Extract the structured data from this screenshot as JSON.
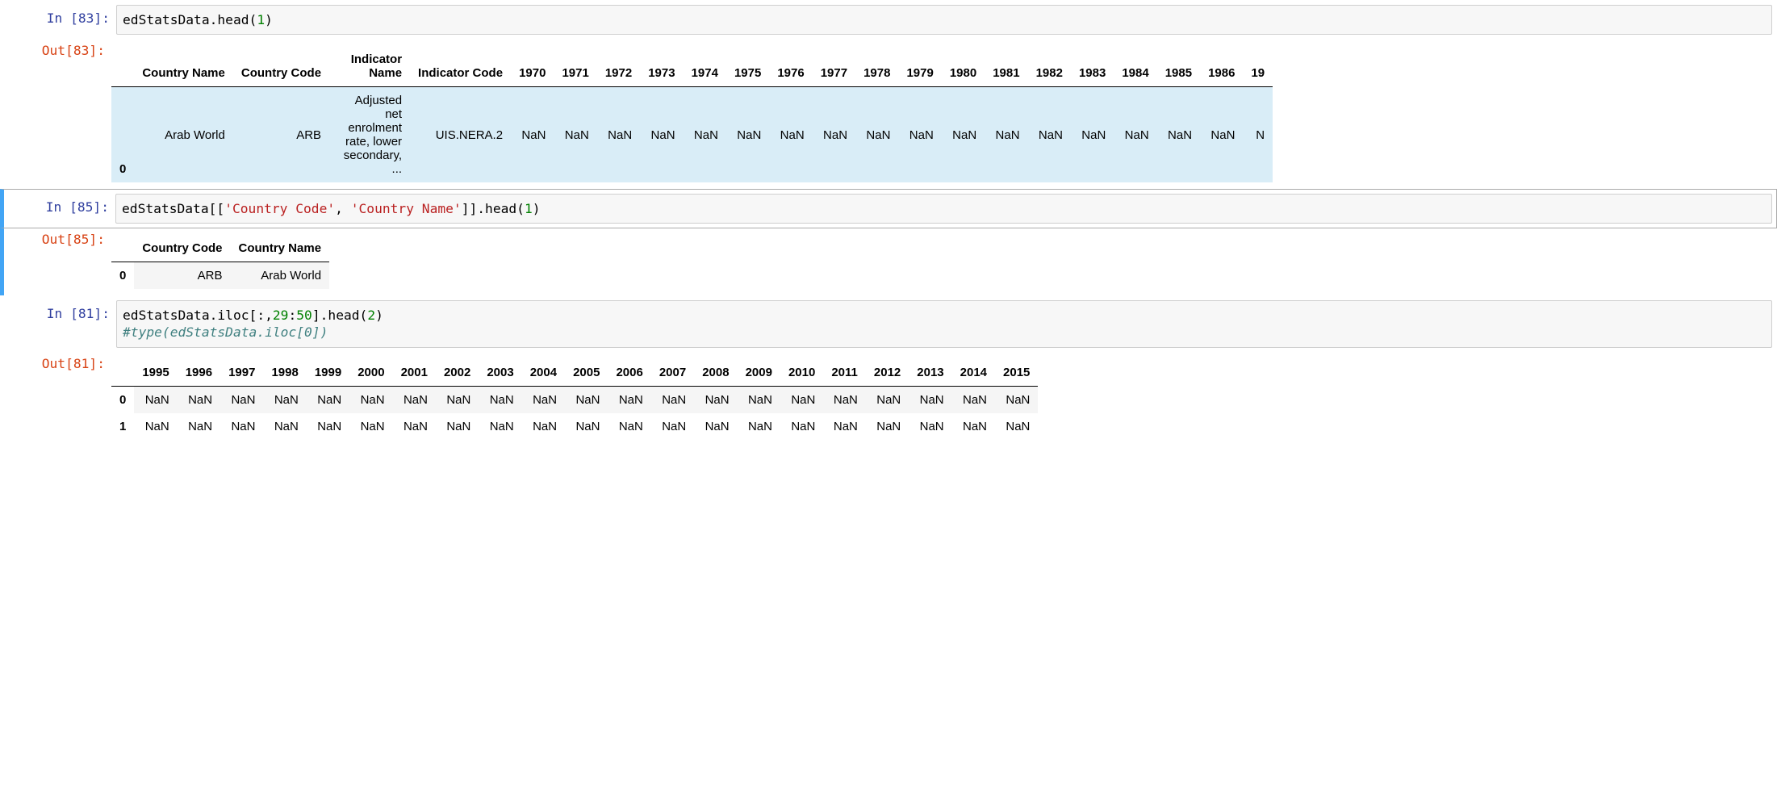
{
  "cells": {
    "c83": {
      "in_label": "In [83]:",
      "out_label": "Out[83]:",
      "code_plain": "edStatsData.head(",
      "code_num": "1",
      "code_tail": ")",
      "table": {
        "headers": [
          "",
          "Country Name",
          "Country Code",
          "Indicator Name",
          "Indicator Code",
          "1970",
          "1971",
          "1972",
          "1973",
          "1974",
          "1975",
          "1976",
          "1977",
          "1978",
          "1979",
          "1980",
          "1981",
          "1982",
          "1983",
          "1984",
          "1985",
          "1986",
          "19"
        ],
        "rows": [
          [
            "0",
            "Arab World",
            "ARB",
            "Adjusted net enrolment rate, lower secondary, ...",
            "UIS.NERA.2",
            "NaN",
            "NaN",
            "NaN",
            "NaN",
            "NaN",
            "NaN",
            "NaN",
            "NaN",
            "NaN",
            "NaN",
            "NaN",
            "NaN",
            "NaN",
            "NaN",
            "NaN",
            "NaN",
            "NaN",
            "N"
          ]
        ]
      }
    },
    "c85": {
      "in_label": "In [85]:",
      "out_label": "Out[85]:",
      "code_plain": "edStatsData[[",
      "code_str1": "'Country Code'",
      "code_mid": ", ",
      "code_str2": "'Country Name'",
      "code_tail": "]].head(",
      "code_num": "1",
      "code_end": ")",
      "table": {
        "headers": [
          "",
          "Country Code",
          "Country Name"
        ],
        "rows": [
          [
            "0",
            "ARB",
            "Arab World"
          ]
        ]
      }
    },
    "c81": {
      "in_label": "In [81]:",
      "out_label": "Out[81]:",
      "code_plain": "edStatsData.iloc[:,",
      "code_num1": "29",
      "code_mid": ":",
      "code_num2": "50",
      "code_tail": "].head(",
      "code_num3": "2",
      "code_end": ")",
      "code_comment": "#type(edStatsData.iloc[0])",
      "table": {
        "headers": [
          "",
          "1995",
          "1996",
          "1997",
          "1998",
          "1999",
          "2000",
          "2001",
          "2002",
          "2003",
          "2004",
          "2005",
          "2006",
          "2007",
          "2008",
          "2009",
          "2010",
          "2011",
          "2012",
          "2013",
          "2014",
          "2015"
        ],
        "rows": [
          [
            "0",
            "NaN",
            "NaN",
            "NaN",
            "NaN",
            "NaN",
            "NaN",
            "NaN",
            "NaN",
            "NaN",
            "NaN",
            "NaN",
            "NaN",
            "NaN",
            "NaN",
            "NaN",
            "NaN",
            "NaN",
            "NaN",
            "NaN",
            "NaN",
            "NaN"
          ],
          [
            "1",
            "NaN",
            "NaN",
            "NaN",
            "NaN",
            "NaN",
            "NaN",
            "NaN",
            "NaN",
            "NaN",
            "NaN",
            "NaN",
            "NaN",
            "NaN",
            "NaN",
            "NaN",
            "NaN",
            "NaN",
            "NaN",
            "NaN",
            "NaN",
            "NaN"
          ]
        ]
      }
    }
  }
}
